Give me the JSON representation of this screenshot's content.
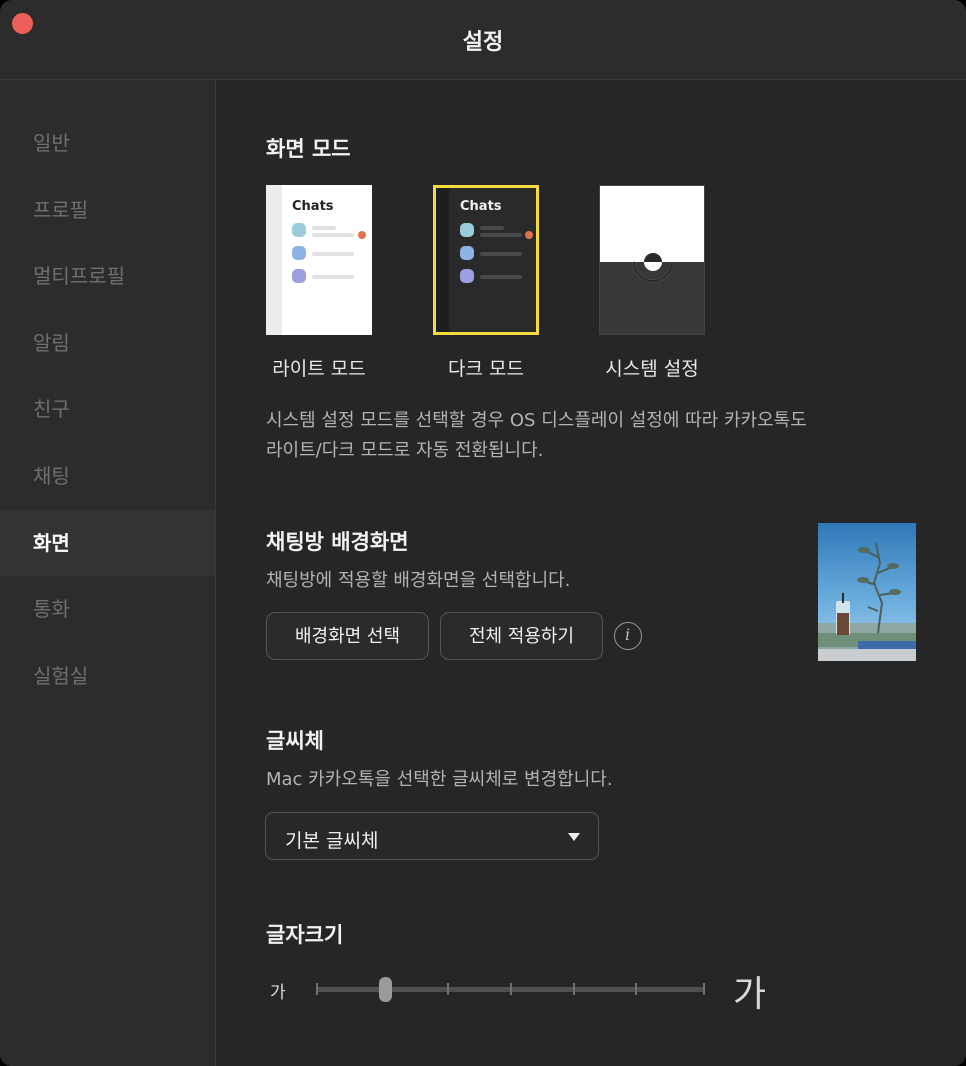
{
  "window": {
    "title": "설정"
  },
  "sidebar": {
    "items": [
      {
        "label": "일반"
      },
      {
        "label": "프로필"
      },
      {
        "label": "멀티프로필"
      },
      {
        "label": "알림"
      },
      {
        "label": "친구"
      },
      {
        "label": "채팅"
      },
      {
        "label": "화면",
        "active": true
      },
      {
        "label": "통화"
      },
      {
        "label": "실험실"
      }
    ]
  },
  "display_mode": {
    "heading": "화면 모드",
    "options": [
      {
        "label": "라이트 모드",
        "preview_title": "Chats"
      },
      {
        "label": "다크 모드",
        "preview_title": "Chats",
        "selected": true
      },
      {
        "label": "시스템 설정"
      }
    ],
    "description_line1": "시스템 설정 모드를 선택할 경우 OS 디스플레이 설정에 따라 카카오톡도",
    "description_line2": "라이트/다크 모드로 자동 전환됩니다."
  },
  "wallpaper": {
    "heading": "채팅방 배경화면",
    "description": "채팅방에 적용할 배경화면을 선택합니다.",
    "select_button": "배경화면 선택",
    "apply_all_button": "전체 적용하기",
    "info_icon": "i"
  },
  "font": {
    "heading": "글씨체",
    "description": "Mac 카카오톡을 선택한 글씨체로 변경합니다.",
    "selected": "기본 글씨체"
  },
  "font_size": {
    "heading": "글자크기",
    "small_label": "가",
    "large_label": "가",
    "steps": 7,
    "current_step": 2
  },
  "colors": {
    "accent_selected": "#f5dc3c",
    "close_button": "#ee5f59",
    "badge": "#e2704e"
  }
}
